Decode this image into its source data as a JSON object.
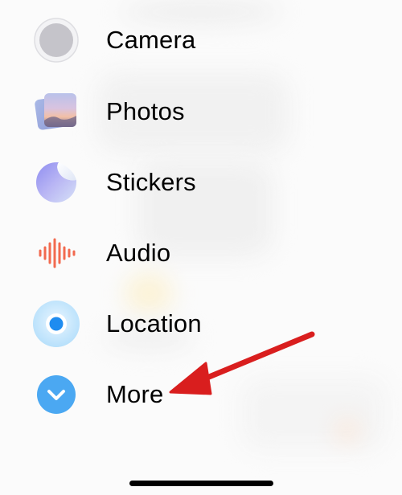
{
  "menu": {
    "items": [
      {
        "label": "Camera",
        "icon": "camera-icon"
      },
      {
        "label": "Photos",
        "icon": "photos-icon"
      },
      {
        "label": "Stickers",
        "icon": "stickers-icon"
      },
      {
        "label": "Audio",
        "icon": "audio-waveform-icon"
      },
      {
        "label": "Location",
        "icon": "location-icon"
      },
      {
        "label": "More",
        "icon": "chevron-down-icon"
      }
    ]
  },
  "annotation": {
    "arrow_color": "#d91e1e",
    "points_to": "More"
  },
  "colors": {
    "audio": "#f26a4f",
    "location": "#1e8cf0",
    "more": "#4ba8f2"
  }
}
